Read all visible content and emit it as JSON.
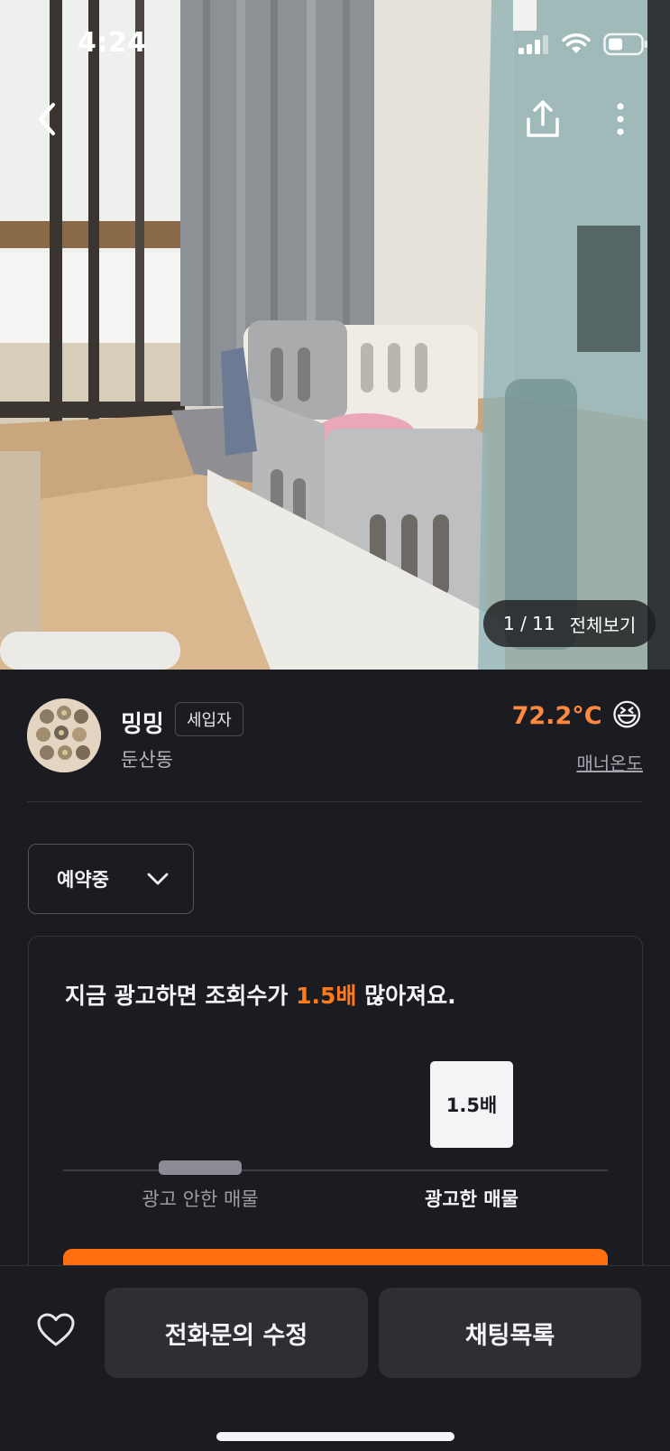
{
  "status_bar": {
    "time": "4:24"
  },
  "photo": {
    "counter": "1 / 11",
    "view_all": "전체보기"
  },
  "seller": {
    "name": "밍밍",
    "badge": "세입자",
    "location": "둔산동",
    "manner_temp": "72.2°C",
    "manner_label": "매너온도",
    "temp_emoji": "😆"
  },
  "status_dropdown": {
    "value": "예약중"
  },
  "ad_card": {
    "headline_pre": "지금 광고하면 조회수가 ",
    "headline_highlight": "1.5배",
    "headline_post": " 많아져요.",
    "bar_ad_value": "1.5배",
    "label_no_ad": "광고 안한 매물",
    "label_ad": "광고한 매물",
    "multiplier": 1.5
  },
  "bottom_bar": {
    "call_button": "전화문의 수정",
    "chat_button": "채팅목록"
  },
  "colors": {
    "accent": "#ff6f0f",
    "temp": "#ff8a3d",
    "background": "#1b1c21"
  }
}
